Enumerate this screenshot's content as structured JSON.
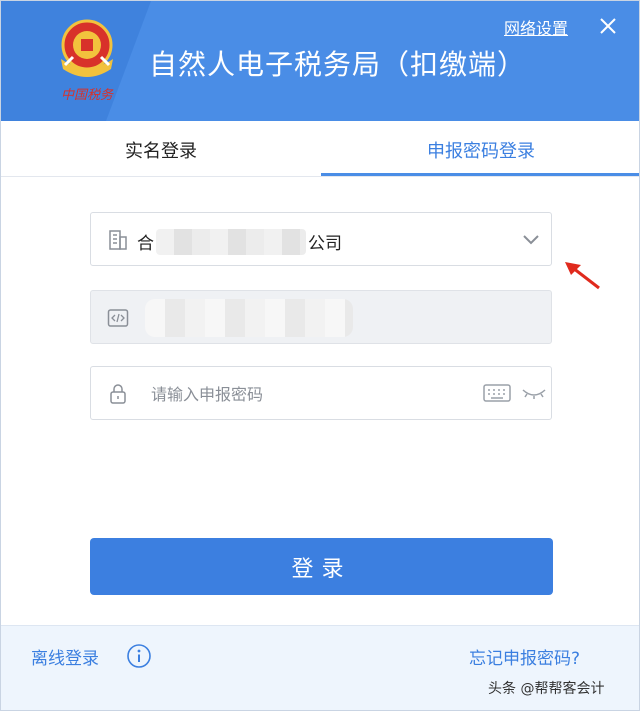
{
  "header": {
    "emblem_caption": "中国税务",
    "app_title": "自然人电子税务局（扣缴端）",
    "network_settings_label": "网络设置",
    "close_icon": "close-icon",
    "brand_color": "#4a8de6"
  },
  "tabs": [
    {
      "label": "实名登录",
      "active": false
    },
    {
      "label": "申报密码登录",
      "active": true
    }
  ],
  "form": {
    "company": {
      "prefix": "合",
      "suffix": "公司",
      "icon": "building-icon",
      "dropdown_icon": "chevron-down-icon"
    },
    "tax_id": {
      "icon": "code-icon"
    },
    "password": {
      "placeholder": "请输入申报密码",
      "value": "",
      "icon": "lock-icon",
      "keyboard_icon": "keyboard-icon",
      "visibility_icon": "eye-closed-icon"
    }
  },
  "login_button": {
    "label": "登录",
    "color": "#3c7fe0"
  },
  "footer": {
    "offline_login_label": "离线登录",
    "forgot_password_label": "忘记申报密码?",
    "watermark": "头条 @帮帮客会计"
  },
  "annotation": {
    "arrow_color": "#e02a1d"
  }
}
